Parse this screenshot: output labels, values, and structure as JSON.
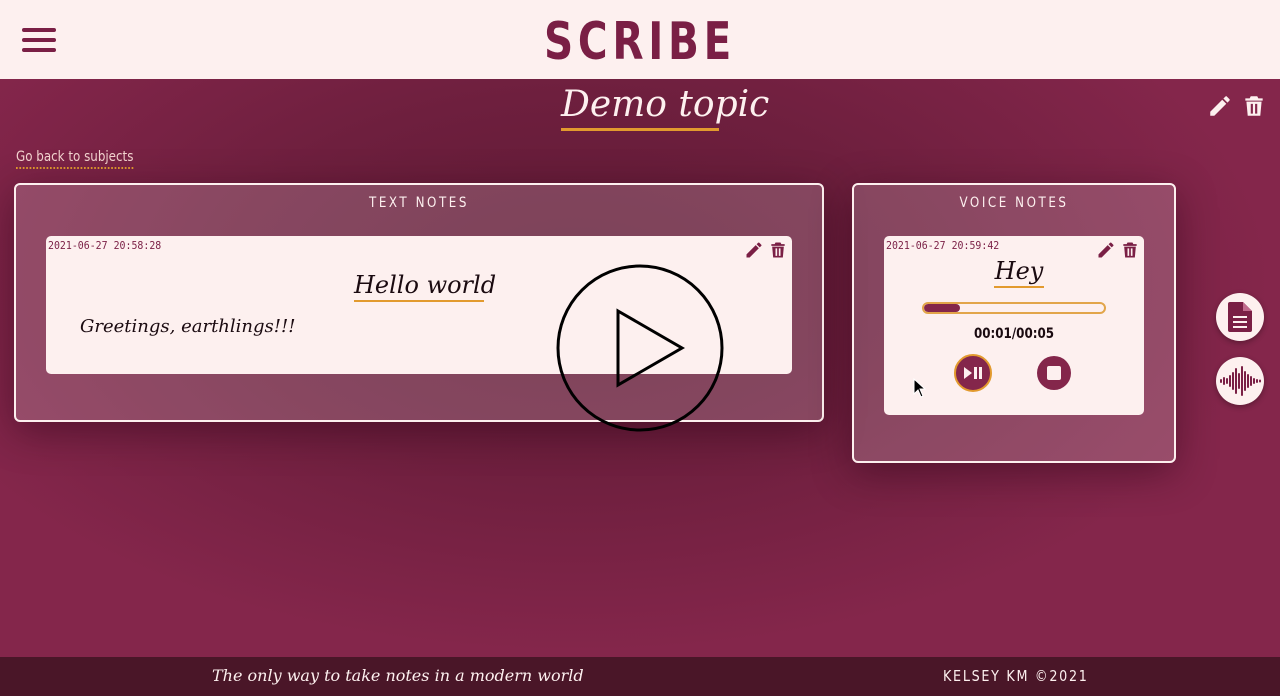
{
  "app": {
    "title": "SCRIBE"
  },
  "topic": {
    "title": "Demo topic"
  },
  "nav": {
    "back_label": "Go back to subjects"
  },
  "text_notes": {
    "heading": "TEXT NOTES",
    "items": [
      {
        "timestamp": "2021-06-27 20:58:28",
        "title": "Hello world",
        "body": "Greetings, earthlings!!!"
      }
    ]
  },
  "voice_notes": {
    "heading": "VOICE NOTES",
    "items": [
      {
        "timestamp": "2021-06-27 20:59:42",
        "title": "Hey",
        "time": "00:01/00:05",
        "progress": 0.2
      }
    ]
  },
  "icons": {
    "menu": "hamburger-menu-icon",
    "edit": "pencil-icon",
    "delete": "trash-icon",
    "play_pause": "play-pause-icon",
    "stop": "stop-icon",
    "add_text_note": "document-icon",
    "add_voice_note": "sound-wave-icon",
    "video_play": "play-icon"
  },
  "colors": {
    "brand": "#7a1f45",
    "background": "#84264b",
    "header": "#fdf0ef",
    "accent": "#e29a2e",
    "footer": "#4a1628"
  },
  "footer": {
    "tagline": "The only way to take notes in a modern world",
    "copyright": "KELSEY KM ©2021"
  }
}
